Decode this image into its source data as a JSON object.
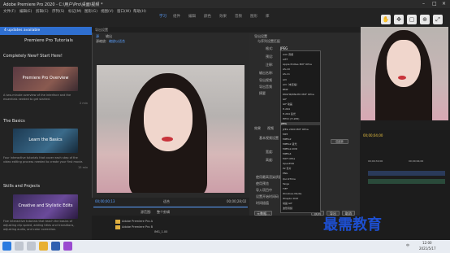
{
  "titlebar": {
    "app_title": "Adobe Premiere Pro 2020 - C:\\用户\\Pro\\桌面\\视频 *"
  },
  "menubar": {
    "items": [
      "文件(F)",
      "编辑(E)",
      "剪辑(C)",
      "序列(S)",
      "标记(M)",
      "图形(G)",
      "视图(V)",
      "窗口(W)",
      "帮助(H)"
    ]
  },
  "workspace_tabs": {
    "items": [
      "学习",
      "组件",
      "编辑",
      "颜色",
      "效果",
      "音频",
      "图形",
      "库"
    ],
    "active": "学习"
  },
  "learn": {
    "updates": "4 updates available",
    "heading": "Premiere Pro Tutorials",
    "section1": "Completely New? Start Here!",
    "card1": {
      "title": "Premiere Pro Overview",
      "desc": "A two-minute overview of the interface and the essentials needed to get started.",
      "time": "2 min"
    },
    "section2": "The Basics",
    "card2": {
      "title": "Learn the Basics",
      "desc": "Four interactive tutorials that cover each step of the video editing process needed to create your first movie.",
      "time": "15 min"
    },
    "section3": "Skills and Projects",
    "card3": {
      "title": "Creative and Stylistic Edits",
      "desc": "Five interactive tutorials that teach the basics of adjusting clip speed, adding titles and transitions, adjusting audio, and color correction.",
      "time": ""
    }
  },
  "dialog": {
    "title": "导出设置",
    "source_tab": "源",
    "output_tab": "输出",
    "source_scale": "源缩放:",
    "source_scale_value": "缩放以适合",
    "timecode_left": "00;00;00;13",
    "timecode_right": "00;00;28;02",
    "fit_label": "适合",
    "range_label": "源范围:",
    "range_value": "整个剪辑"
  },
  "export_settings": {
    "header": "导出设置",
    "match_sequence": "与序列设置匹配",
    "format_label": "格式:",
    "format_value": "JPEG",
    "preset_label": "预设:",
    "comment_label": "注释:",
    "output_label": "输出名称:",
    "export_video": "导出视频",
    "export_audio": "导出音频",
    "summary_label": "摘要",
    "effects_tab": "效果",
    "video_tab": "视频",
    "basic_settings": "基本视频设置",
    "width_label": "宽度:",
    "height_label": "高度:",
    "match_source": "匹配源",
    "use_max_render": "使用最高渲染质量",
    "use_previews": "使用预览",
    "import_project": "导入项目中",
    "set_start_tc": "设置开始时间码",
    "time_interp": "时间插值",
    "queue_btn": "队列",
    "export_btn": "导出",
    "cancel_btn": "取消",
    "metadata_btn": "元数据..."
  },
  "format_list": [
    "AAC 音频",
    "AIFF",
    "Apple ProRes MXF OP1a",
    "AS-10",
    "AS-11",
    "AVI",
    "AVI（未压缩）",
    "BMP",
    "DNxHR/DNxHD MXF OP1a",
    "GIF",
    "GIF 动画",
    "H.264",
    "H.264 蓝光",
    "HEVC (H.265)",
    "JPEG",
    "JPEG 2000 MXF OP1a",
    "MP3",
    "MPEG2",
    "MPEG2 蓝光",
    "MPEG2-DVD",
    "MPEG4",
    "MXF OP1a",
    "OpenEXR",
    "P2 影片",
    "PNG",
    "QuickTime",
    "Targa",
    "TIFF",
    "Windows Media",
    "Wraptor DCP",
    "动画 GIF",
    "波形音频"
  ],
  "format_selected": "JPEG",
  "timeline": {
    "timecode": "00;00;04;00",
    "labels": [
      "00;00;32;00",
      "00;00;64;00"
    ]
  },
  "project": {
    "file1": "Adobe Premiere Pro A",
    "file2": "Adobe Premiere Pro B",
    "clip": "IMG_1.00"
  },
  "taskbar": {
    "time": "12:00",
    "date": "2021/5/17",
    "lang": "中"
  },
  "watermark": "最需教育"
}
